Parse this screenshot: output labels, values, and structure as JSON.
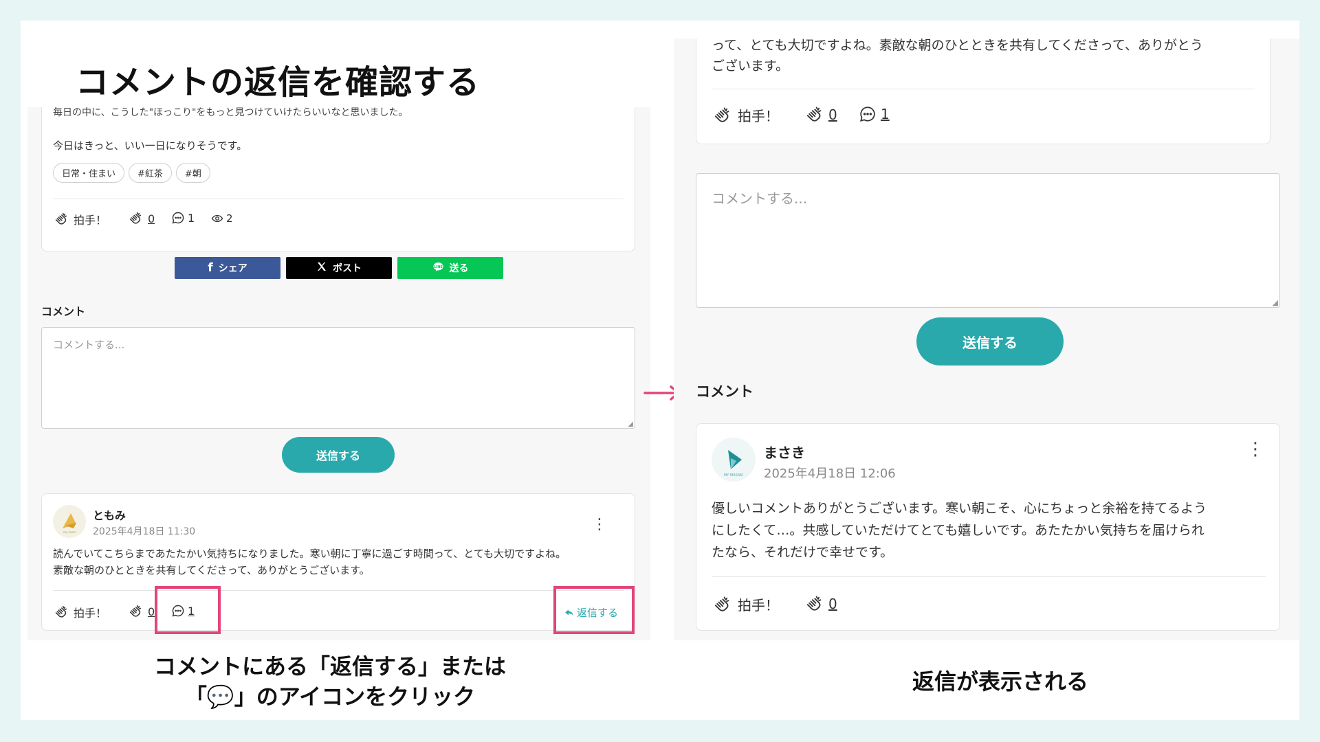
{
  "page_title": "コメントの返信を確認する",
  "left": {
    "article_cut_text": "毎日の中に、こうした\"ほっこり\"をもっと見つけていけたらいいなと思いました。",
    "article_text": "今日はきっと、いい一日になりそうです。",
    "tags": [
      "日常・住まい",
      "#紅茶",
      "#朝"
    ],
    "article_actions": {
      "clap_label": "拍手！",
      "clap_count": "0",
      "comment_count": "1",
      "view_count": "2"
    },
    "share": {
      "facebook": "シェア",
      "x": "ポスト",
      "line": "送る"
    },
    "comment_heading": "コメント",
    "comment_placeholder": "コメントする...",
    "send_label": "送信する",
    "comment": {
      "author": "ともみ",
      "date": "2025年4月18日 11:30",
      "body_line1": "読んでいてこちらまであたたかい気持ちになりました。寒い朝に丁寧に過ごす時間って、とても大切ですよね。",
      "body_line2": "素敵な朝のひとときを共有してくださって、ありがとうございます。",
      "clap_label": "拍手！",
      "clap_count": "0",
      "reply_count": "1",
      "reply_label": "返信する"
    }
  },
  "right": {
    "top_cut_text": "って、とても大切ですよね。素敵な朝のひとときを共有してくださって、ありがとう",
    "top_text": "ございます。",
    "top_actions": {
      "clap_label": "拍手！",
      "clap_count": "0",
      "comment_count": "1"
    },
    "comment_placeholder": "コメントする...",
    "send_label": "送信する",
    "comment_heading": "コメント",
    "reply": {
      "author": "まさき",
      "date": "2025年4月18日 12:06",
      "body_line1": "優しいコメントありがとうございます。寒い朝こそ、心にちょっと余裕を持てるよう",
      "body_line2": "にしたくて…。共感していただけてとても嬉しいです。あたたかい気持ちを届けられ",
      "body_line3": "たなら、それだけで幸せです。",
      "clap_label": "拍手！",
      "clap_count": "0"
    }
  },
  "captions": {
    "left_line1": "コメントにある「返信する」または",
    "left_line2": "「💬」のアイコンをクリック",
    "right": "返信が表示される"
  },
  "colors": {
    "accent": "#2aa9ad",
    "highlight": "#e2457a",
    "facebook": "#3b5998",
    "x": "#000000",
    "line": "#06c755",
    "background": "#e7f5f5"
  },
  "icons": [
    "clap-icon",
    "comment-icon",
    "eye-icon",
    "reply-arrow-icon",
    "facebook-icon",
    "x-logo-icon",
    "line-icon",
    "kebab-menu-icon",
    "arrow-right-icon"
  ]
}
